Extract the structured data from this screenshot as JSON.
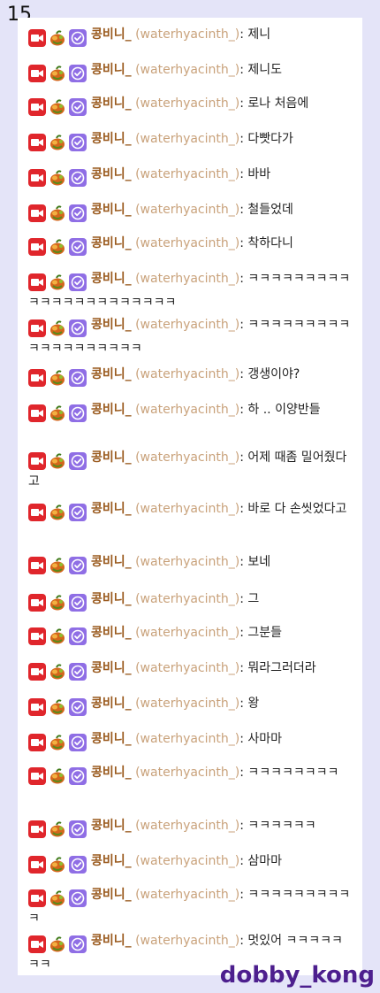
{
  "page_number": "15",
  "watermark": "dobby_kong",
  "chat": {
    "badges": [
      "video-camera-icon",
      "sub-badge-icon",
      "verified-check-icon"
    ],
    "messages": [
      {
        "user": "콩비니_",
        "login": "(waterhyacinth_)",
        "sep": ":",
        "text": "제니"
      },
      {
        "user": "콩비니_",
        "login": "(waterhyacinth_)",
        "sep": ":",
        "text": "제니도"
      },
      {
        "user": "콩비니_",
        "login": "(waterhyacinth_)",
        "sep": ":",
        "text": "로나 처음에"
      },
      {
        "user": "콩비니_",
        "login": "(waterhyacinth_)",
        "sep": ":",
        "text": "다빳다가"
      },
      {
        "user": "콩비니_",
        "login": "(waterhyacinth_)",
        "sep": ":",
        "text": "바바"
      },
      {
        "user": "콩비니_",
        "login": "(waterhyacinth_)",
        "sep": ":",
        "text": "철들었데"
      },
      {
        "user": "콩비니_",
        "login": "(waterhyacinth_)",
        "sep": ":",
        "text": "착하다니"
      },
      {
        "user": "콩비니_",
        "login": "(waterhyacinth_)",
        "sep": ":",
        "text": "ㅋㅋㅋㅋㅋㅋㅋㅋㅋㅋㅋㅋㅋㅋㅋㅋㅋㅋㅋㅋㅋㅋ"
      },
      {
        "user": "콩비니_",
        "login": "(waterhyacinth_)",
        "sep": ":",
        "text": "ㅋㅋㅋㅋㅋㅋㅋㅋㅋㅋㅋㅋㅋㅋㅋㅋㅋㅋㅋ"
      },
      {
        "user": "콩비니_",
        "login": "(waterhyacinth_)",
        "sep": ":",
        "text": "갱생이야?"
      },
      {
        "user": "콩비니_",
        "login": "(waterhyacinth_)",
        "sep": ":",
        "text": "하 .. 이양반들"
      },
      {
        "user": "콩비니_",
        "login": "(waterhyacinth_)",
        "sep": ":",
        "text": "어제 때좀 밀어줬다고"
      },
      {
        "user": "콩비니_",
        "login": "(waterhyacinth_)",
        "sep": ":",
        "text": "바로 다 손씻었다고"
      },
      {
        "user": "콩비니_",
        "login": "(waterhyacinth_)",
        "sep": ":",
        "text": "보네"
      },
      {
        "user": "콩비니_",
        "login": "(waterhyacinth_)",
        "sep": ":",
        "text": "그"
      },
      {
        "user": "콩비니_",
        "login": "(waterhyacinth_)",
        "sep": ":",
        "text": "그분들"
      },
      {
        "user": "콩비니_",
        "login": "(waterhyacinth_)",
        "sep": ":",
        "text": "뭐라그러더라"
      },
      {
        "user": "콩비니_",
        "login": "(waterhyacinth_)",
        "sep": ":",
        "text": "왕"
      },
      {
        "user": "콩비니_",
        "login": "(waterhyacinth_)",
        "sep": ":",
        "text": "사마마"
      },
      {
        "user": "콩비니_",
        "login": "(waterhyacinth_)",
        "sep": ":",
        "text": "ㅋㅋㅋㅋㅋㅋㅋㅋ"
      },
      {
        "user": "콩비니_",
        "login": "(waterhyacinth_)",
        "sep": ":",
        "text": "ㅋㅋㅋㅋㅋㅋ"
      },
      {
        "user": "콩비니_",
        "login": "(waterhyacinth_)",
        "sep": ":",
        "text": "삼마마"
      },
      {
        "user": "콩비니_",
        "login": "(waterhyacinth_)",
        "sep": ":",
        "text": "ㅋㅋㅋㅋㅋㅋㅋㅋㅋㅋ"
      },
      {
        "user": "콩비니_",
        "login": "(waterhyacinth_)",
        "sep": ":",
        "text": "멋있어 ㅋㅋㅋㅋㅋㅋㅋ"
      }
    ]
  }
}
